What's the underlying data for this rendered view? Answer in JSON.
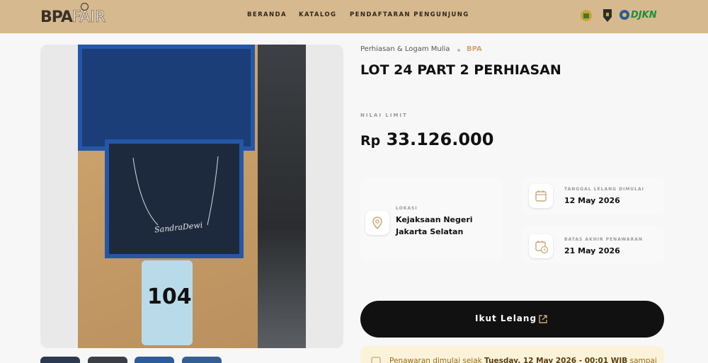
{
  "header": {
    "logo_bpa": "BPA",
    "logo_fair": "FAIR",
    "nav": [
      "BERANDA",
      "KATALOG",
      "PENDAFTARAN PENGUNJUNG"
    ],
    "partner_text": "DJKN"
  },
  "gallery": {
    "tag_number": "104",
    "necklace_text": "SandraDewi"
  },
  "product": {
    "category": "Perhiasan & Logam Mulia",
    "seller": "BPA",
    "title": "LOT 24 PART 2 PERHIASAN",
    "limit_label": "NILAI LIMIT",
    "currency": "Rp",
    "price": "33.126.000"
  },
  "location": {
    "label": "LOKASI",
    "line1": "Kejaksaan Negeri",
    "line2": "Jakarta Selatan"
  },
  "start_date": {
    "label": "TANGGAL LELANG DIMULAI",
    "value": "12 May 2026"
  },
  "end_date": {
    "label": "BATAS AKHIR PENAWARAN",
    "value": "21 May 2026"
  },
  "cta": {
    "label": "Ikut Lelang"
  },
  "notice": {
    "prefix": "Penawaran dimulai sejak ",
    "datetime": "Tuesday, 12 May 2026 - 00:01 WIB",
    "suffix": " sampai"
  },
  "colors": {
    "header_bg": "#d7b98f",
    "accent_gold": "#c8a979",
    "cta_bg": "#111111",
    "notice_bg": "#fbf3d9"
  }
}
